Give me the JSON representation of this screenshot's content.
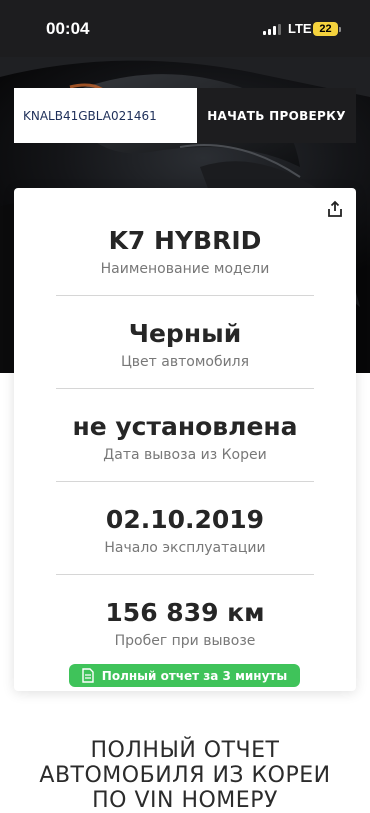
{
  "status_bar": {
    "time": "00:04",
    "network": "LTE",
    "battery": "22",
    "colors": {
      "battery": "#f4d23d"
    }
  },
  "search": {
    "vin_value": "KNALB41GBLA021461",
    "button_label": "НАЧАТЬ ПРОВЕРКУ"
  },
  "card": {
    "fields": [
      {
        "value": "K7 HYBRID",
        "label": "Наименование модели"
      },
      {
        "value": "Черный",
        "label": "Цвет автомобиля"
      },
      {
        "value": "не установлена",
        "label": "Дата вывоза из Кореи"
      },
      {
        "value": "02.10.2019",
        "label": "Начало эксплуатации"
      },
      {
        "value": "156 839 км",
        "label": "Пробег при вывозе"
      }
    ],
    "report_badge": "Полный отчет за 3 минуты",
    "colors": {
      "badge": "#3fc35a"
    }
  },
  "section": {
    "title_lines": [
      "ПОЛНЫЙ ОТЧЕТ",
      "АВТОМОБИЛЯ ИЗ КОРЕИ",
      "ПО VIN НОМЕРУ"
    ]
  },
  "icons": [
    "signal-icon",
    "battery-icon",
    "share-icon",
    "document-icon"
  ]
}
